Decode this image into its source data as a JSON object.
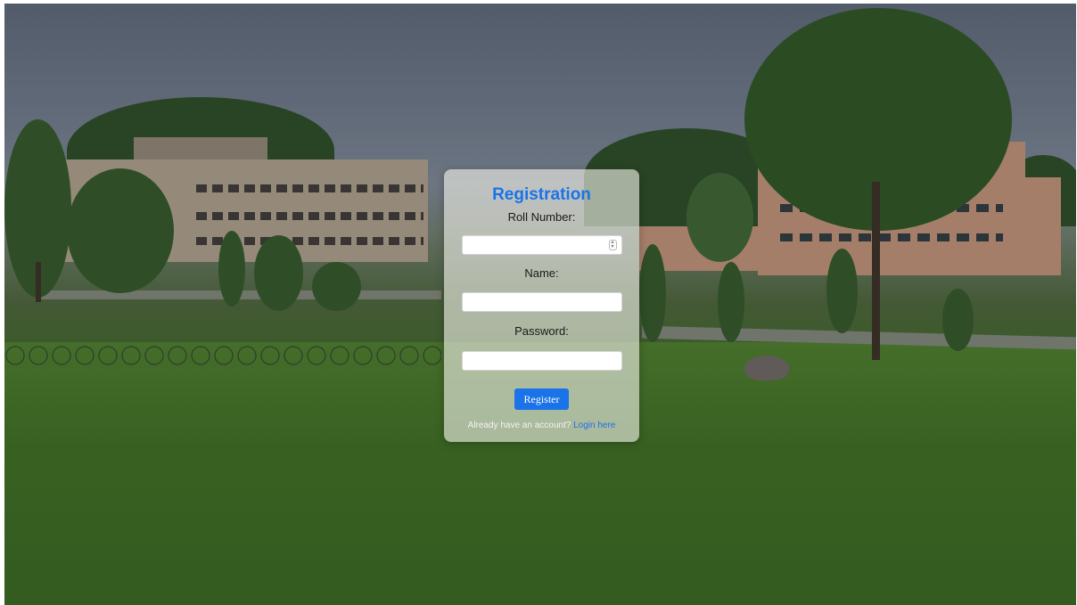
{
  "form": {
    "title": "Registration",
    "roll_label": "Roll Number:",
    "roll_value": "",
    "name_label": "Name:",
    "name_value": "",
    "password_label": "Password:",
    "password_value": "",
    "register_label": "Register",
    "login_prompt": "Already have an account?",
    "login_link": "Login here"
  },
  "icons": {
    "roll_spinner": "number-spinner-icon"
  },
  "colors": {
    "accent": "#1a73e8",
    "button_text": "#ffffff"
  }
}
